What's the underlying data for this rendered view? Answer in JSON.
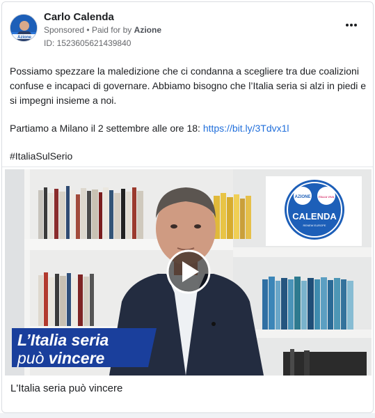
{
  "advertiser": {
    "name": "Carlo Calenda",
    "sponsored_label": "Sponsored",
    "paid_for_prefix": "Paid for by",
    "paid_for_by": "Azione",
    "ad_id": "ID: 1523605621439840"
  },
  "post": {
    "paragraph_1": "Possiamo spezzare la maledizione che ci condanna a scegliere tra due coalizioni confuse e incapaci di governare. Abbiamo bisogno che l’Italia seria si alzi in piedi e si impegni insieme a noi.",
    "paragraph_2_text": "Partiamo a Milano il 2 settembre alle ore 18:",
    "paragraph_2_link": "https://bit.ly/3Tdvx1l",
    "hashtag": "#ItaliaSulSerio"
  },
  "video": {
    "overlay_line_1": "L’Italia seria",
    "overlay_line_2_prefix": "può ",
    "overlay_line_2_emph": "vincere",
    "poster_brand_1": "AZIONE",
    "poster_brand_2": "ITALIA VIVA",
    "poster_name": "CALENDA",
    "poster_sub": "RENEW EUROPE",
    "avatar_tag": "Azione"
  },
  "caption": "L'Italia seria può vincere",
  "colors": {
    "brand_blue": "#1d5fb8",
    "link": "#216fdb",
    "overlay_blue": "#1a3f9c"
  },
  "icons": {
    "more": "three-dots-icon",
    "play": "play-icon"
  }
}
